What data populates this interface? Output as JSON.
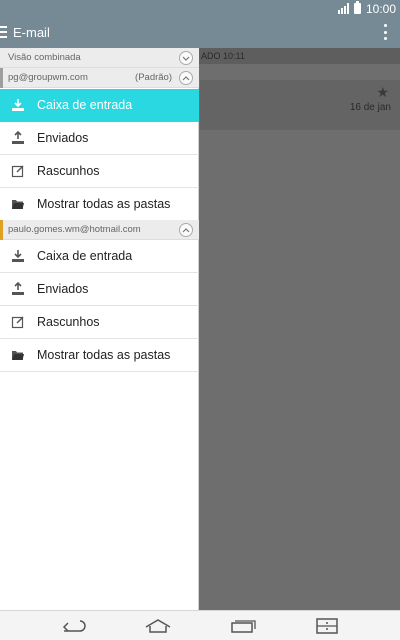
{
  "status_bar": {
    "time": "10:00",
    "icons": [
      "signal-icon",
      "battery-icon"
    ]
  },
  "app_bar": {
    "title": "E-mail",
    "menu_icon": "menu-icon",
    "overflow_icon": "overflow-menu-icon"
  },
  "background": {
    "header_text": "ADO 10:11",
    "date": "16 de jan",
    "star_icon": "star-icon"
  },
  "drawer": {
    "combined_header": "Visão combinada",
    "accounts": [
      {
        "email": "pg@groupwm.com",
        "tag": "(Padrão)",
        "accent_color": "#9e9e9e",
        "items": [
          {
            "label": "Caixa de entrada",
            "icon": "inbox-icon",
            "active": true
          },
          {
            "label": "Enviados",
            "icon": "sent-icon",
            "active": false
          },
          {
            "label": "Rascunhos",
            "icon": "drafts-icon",
            "active": false
          },
          {
            "label": "Mostrar todas as pastas",
            "icon": "folder-icon",
            "active": false
          }
        ]
      },
      {
        "email": "paulo.gomes.wm@hotmail.com",
        "tag": "",
        "accent_color": "#e0a020",
        "items": [
          {
            "label": "Caixa de entrada",
            "icon": "inbox-icon",
            "active": false
          },
          {
            "label": "Enviados",
            "icon": "sent-icon",
            "active": false
          },
          {
            "label": "Rascunhos",
            "icon": "drafts-icon",
            "active": false
          },
          {
            "label": "Mostrar todas as pastas",
            "icon": "folder-icon",
            "active": false
          }
        ]
      }
    ]
  },
  "nav_bar": {
    "buttons": [
      "back-icon",
      "home-icon",
      "recents-icon",
      "dual-window-icon"
    ]
  },
  "colors": {
    "accent": "#29d8e0",
    "app_bar": "#768a96"
  }
}
